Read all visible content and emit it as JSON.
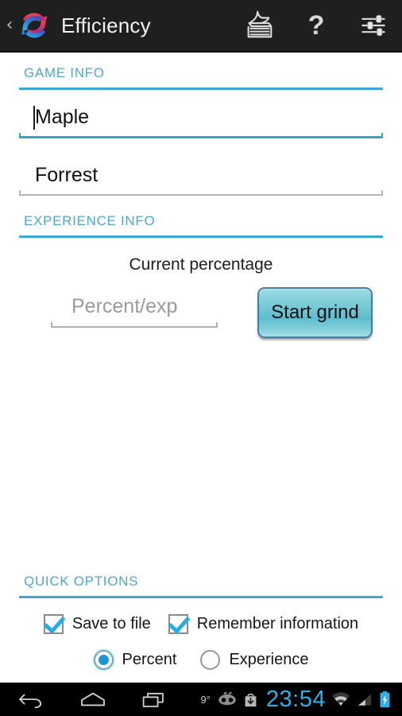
{
  "app": {
    "title": "Efficiency",
    "logo_icon": "sync-circular-arrows-icon",
    "up_caret_icon": "back-caret-icon"
  },
  "action_bar": {
    "actions": [
      {
        "name": "paper-stack-icon",
        "label": ""
      },
      {
        "name": "help-question-icon",
        "label": "?"
      },
      {
        "name": "settings-sliders-icon",
        "label": ""
      }
    ],
    "help_glyph": "?"
  },
  "sections": {
    "game_info": {
      "header": "GAME INFO",
      "fields": [
        {
          "name": "character-name",
          "value": "Maple",
          "placeholder": "",
          "focused": true
        },
        {
          "name": "location-name",
          "value": "Forrest",
          "placeholder": "",
          "focused": false
        }
      ]
    },
    "experience_info": {
      "header": "EXPERIENCE INFO",
      "current_percentage_label": "Current percentage",
      "percent_input": {
        "value": "",
        "placeholder": "Percent/exp"
      },
      "start_button": "Start grind"
    },
    "quick_options": {
      "header": "QUICK OPTIONS",
      "checkboxes": [
        {
          "label": "Save to file",
          "checked": true
        },
        {
          "label": "Remember information",
          "checked": true
        }
      ],
      "radios": [
        {
          "label": "Percent",
          "selected": true
        },
        {
          "label": "Experience",
          "selected": false
        }
      ]
    }
  },
  "nav_bar": {
    "buttons": [
      {
        "name": "back-icon"
      },
      {
        "name": "home-icon"
      },
      {
        "name": "recents-icon"
      }
    ],
    "status": {
      "temperature": "9°",
      "cyanogenmod_icon": "cyanogenmod-cid-icon",
      "download_icon": "play-store-download-icon",
      "clock": "23:54",
      "wifi_icon": "wifi-icon",
      "signal_icon": "cellular-signal-icon",
      "battery_icon": "battery-charging-icon"
    }
  },
  "colors": {
    "accent_blue": "#37a9d4",
    "header_text": "#4da8c8",
    "clock_blue": "#2fb0e8",
    "action_bar_bg": "#1f1f1f",
    "button_teal": "#76c9d6"
  }
}
